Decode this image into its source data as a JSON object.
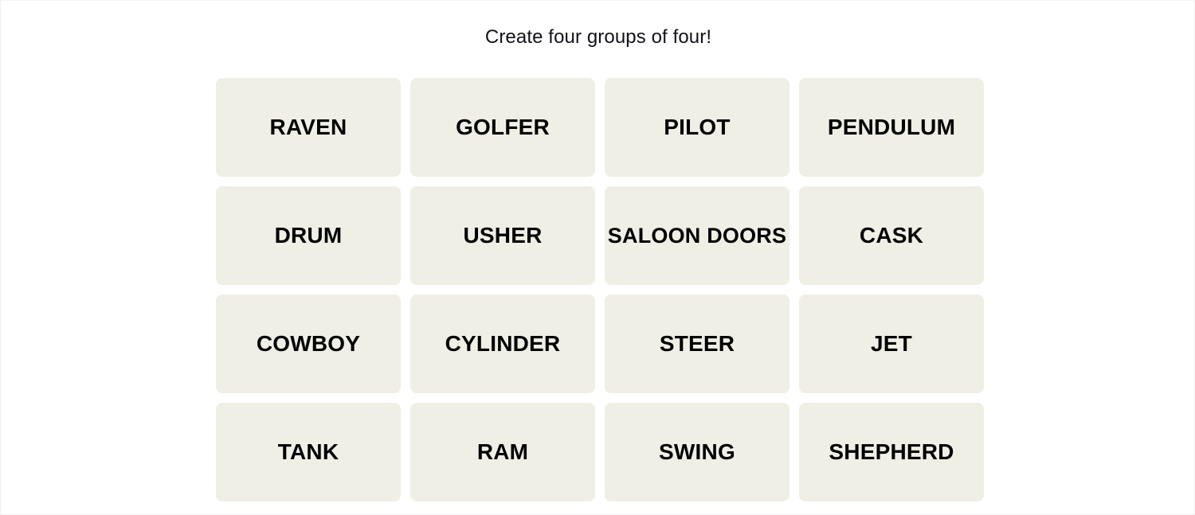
{
  "page": {
    "background_color": "#ffffff",
    "border_color": "#f0f0f0"
  },
  "game": {
    "title": "Create four groups of four!",
    "title_color": "#12121a",
    "tile_color": "#efefe6",
    "tile_text_color": "#000000",
    "grid": {
      "rows": 4,
      "columns": 4,
      "tiles": [
        {
          "label": "RAVEN"
        },
        {
          "label": "GOLFER"
        },
        {
          "label": "PILOT"
        },
        {
          "label": "PENDULUM"
        },
        {
          "label": "DRUM"
        },
        {
          "label": "USHER"
        },
        {
          "label": "SALOON DOORS"
        },
        {
          "label": "CASK"
        },
        {
          "label": "COWBOY"
        },
        {
          "label": "CYLINDER"
        },
        {
          "label": "STEER"
        },
        {
          "label": "JET"
        },
        {
          "label": "TANK"
        },
        {
          "label": "RAM"
        },
        {
          "label": "SWING"
        },
        {
          "label": "SHEPHERD"
        }
      ]
    }
  }
}
